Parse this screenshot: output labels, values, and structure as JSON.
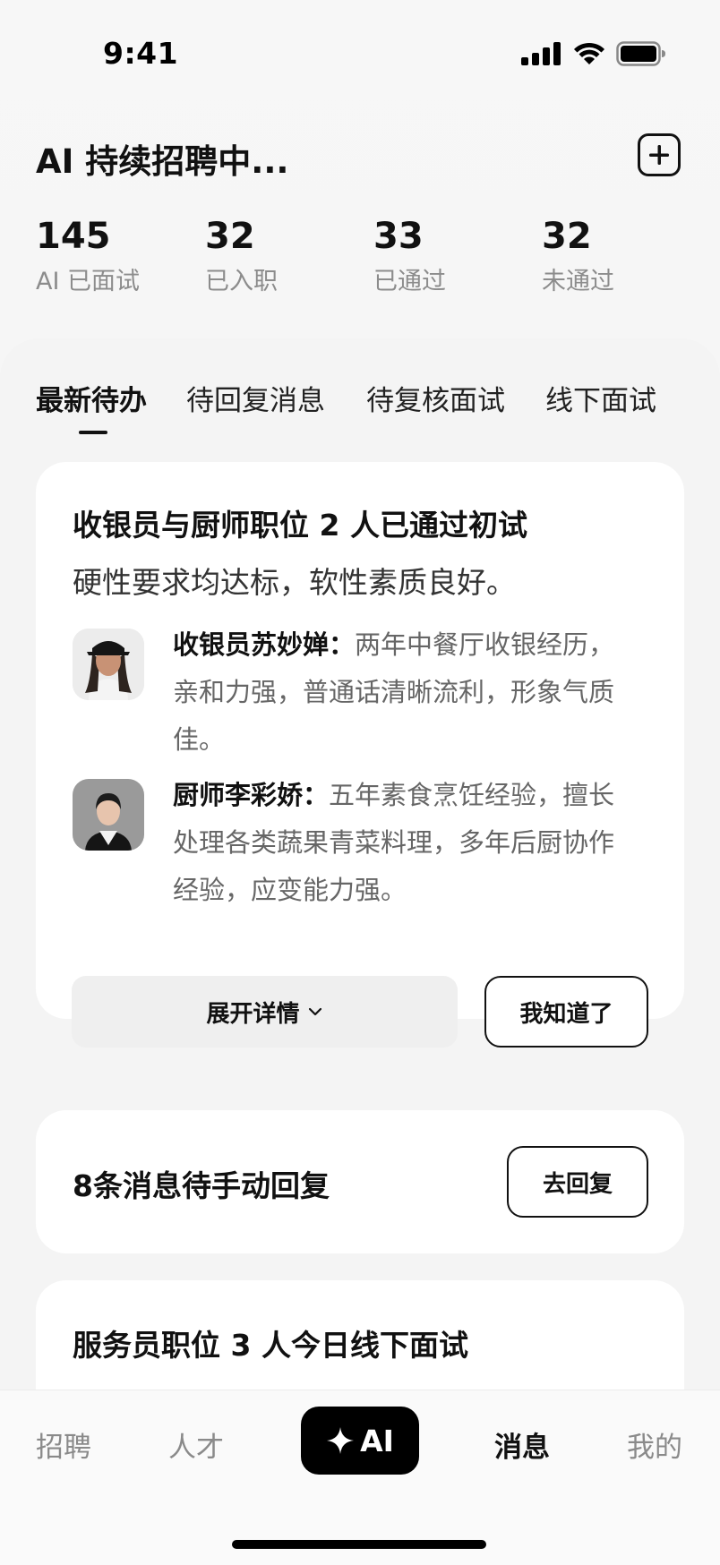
{
  "status_bar": {
    "time": "9:41"
  },
  "header": {
    "title": "AI 持续招聘中...",
    "add_icon": "plus-square-icon"
  },
  "stats": [
    {
      "value": "145",
      "label": "AI 已面试"
    },
    {
      "value": "32",
      "label": "已入职"
    },
    {
      "value": "33",
      "label": "已通过"
    },
    {
      "value": "32",
      "label": "未通过"
    }
  ],
  "tabs": [
    {
      "label": "最新待办",
      "active": true
    },
    {
      "label": "待回复消息",
      "active": false
    },
    {
      "label": "待复核面试",
      "active": false
    },
    {
      "label": "线下面试",
      "active": false
    }
  ],
  "cards": {
    "interview_result": {
      "title": "收银员与厨师职位 2 人已通过初试",
      "subtitle": "硬性要求均达标，软性素质良好。",
      "candidates": [
        {
          "name": "收银员苏妙婵：",
          "summary": "两年中餐厅收银经历，亲和力强，普通话清晰流利，形象气质佳。"
        },
        {
          "name": "厨师李彩娇：",
          "summary": "五年素食烹饪经验，擅长处理各类蔬果青菜料理，多年后厨协作经验，应变能力强。"
        }
      ],
      "expand_label": "展开详情",
      "ack_label": "我知道了"
    },
    "messages": {
      "title": "8条消息待手动回复",
      "reply_label": "去回复"
    },
    "offline_interview": {
      "title": "服务员职位 3 人今日线下面试"
    }
  },
  "bottom_nav": {
    "items": [
      {
        "label": "招聘",
        "active": false
      },
      {
        "label": "人才",
        "active": false
      },
      {
        "label": "AI",
        "active": false
      },
      {
        "label": "消息",
        "active": true
      },
      {
        "label": "我的",
        "active": false
      }
    ]
  }
}
